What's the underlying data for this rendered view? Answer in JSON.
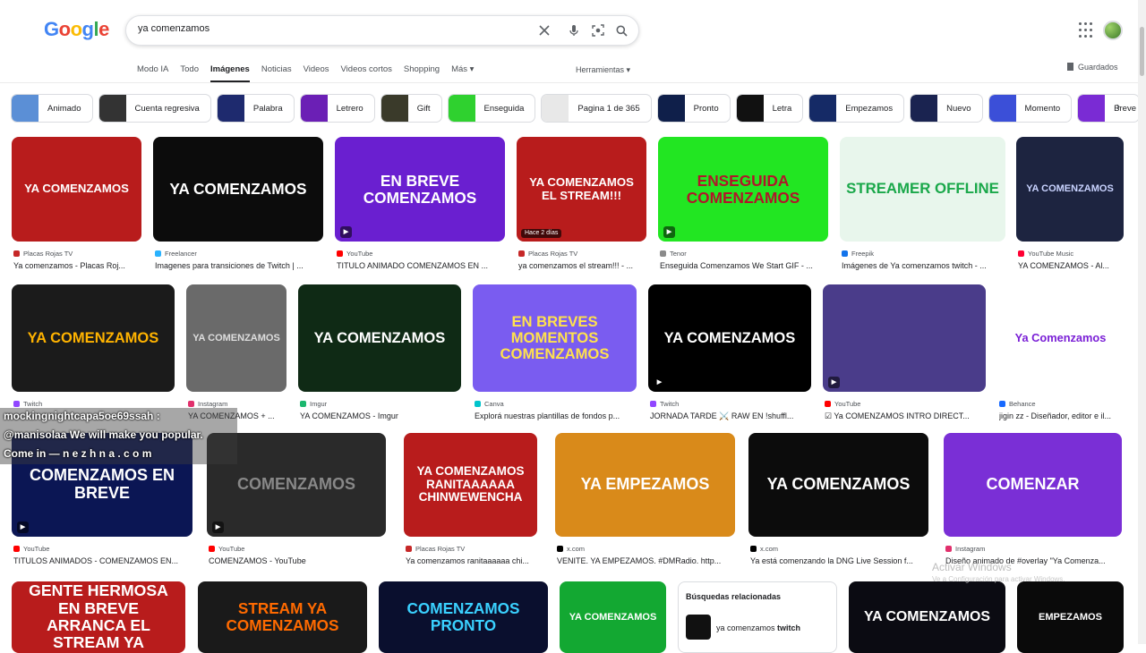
{
  "logo": {
    "letters": [
      "G",
      "o",
      "o",
      "g",
      "l",
      "e"
    ],
    "colors": [
      "#4285f4",
      "#ea4335",
      "#fbbc05",
      "#4285f4",
      "#34a853",
      "#ea4335"
    ]
  },
  "search": {
    "value": "ya comenzamos"
  },
  "tabs": [
    "Modo IA",
    "Todo",
    "Imágenes",
    "Noticias",
    "Videos",
    "Videos cortos",
    "Shopping",
    "Más ▾"
  ],
  "active_tab": "Imágenes",
  "tools_label": "Herramientas ▾",
  "saved_label": "Guardados",
  "chips": [
    {
      "label": "Animado",
      "color": "#5b8fd6"
    },
    {
      "label": "Cuenta regresiva",
      "color": "#333333"
    },
    {
      "label": "Palabra",
      "color": "#1e2a6e"
    },
    {
      "label": "Letrero",
      "color": "#6b1fb5"
    },
    {
      "label": "Gift",
      "color": "#3a3a2a"
    },
    {
      "label": "Enseguida",
      "color": "#2fd12f"
    },
    {
      "label": "Pagina 1 de 365",
      "color": "#e8e8e8"
    },
    {
      "label": "Pronto",
      "color": "#0f1f4a"
    },
    {
      "label": "Letra",
      "color": "#111111"
    },
    {
      "label": "Empezamos",
      "color": "#152a66"
    },
    {
      "label": "Nuevo",
      "color": "#1a2350"
    },
    {
      "label": "Momento",
      "color": "#3b4fd8"
    },
    {
      "label": "Breve",
      "color": "#7a2bd4"
    }
  ],
  "chat": {
    "line1": "mockingnightcapa5oe69ssah :",
    "line2": "@manisolaa We will make you popular.",
    "line3": "Come in — n e z h n a . c o m"
  },
  "row1": [
    {
      "text": "YA COMENZAMOS",
      "bg": "#b81c1c",
      "fg": "#ffffff",
      "src": "Placas Rojas TV",
      "icon": "#c62828",
      "title": "Ya comenzamos - Placas Roj...",
      "play": false
    },
    {
      "text": "YA COMENZAMOS",
      "bg": "#0c0c0c",
      "fg": "#ffffff",
      "src": "Freelancer",
      "icon": "#29b2fe",
      "title": "Imagenes para transiciones de Twitch | ...",
      "play": false
    },
    {
      "text": "EN BREVE COMENZAMOS",
      "bg": "#6a1fd0",
      "fg": "#ffffff",
      "src": "YouTube",
      "icon": "#ff0000",
      "title": "TITULO ANIMADO COMENZAMOS EN ...",
      "play": true
    },
    {
      "text": "YA COMENZAMOS EL STREAM!!!",
      "bg": "#b81c1c",
      "fg": "#ffffff",
      "src": "Placas Rojas TV",
      "icon": "#c62828",
      "title": "ya comenzamos el stream!!! - ...",
      "badge": "Hace 2 días"
    },
    {
      "text": "ENSEGUIDA COMENZAMOS",
      "bg": "#22e622",
      "fg": "#b0162a",
      "src": "Tenor",
      "icon": "#8a8a8a",
      "title": "Enseguida Comenzamos We Start GIF - ...",
      "play": true
    },
    {
      "text": "STREAMER OFFLINE",
      "bg": "#e8f6ec",
      "fg": "#1aa84a",
      "src": "Freepik",
      "icon": "#1273eb",
      "title": "Imágenes de Ya comenzamos twitch - ...",
      "play": false
    },
    {
      "text": "YA COMENZAMOS",
      "bg": "#1d2440",
      "fg": "#c9d3ff",
      "src": "YouTube Music",
      "icon": "#ff0033",
      "title": "YA COMENZAMOS - Al...",
      "play": false
    }
  ],
  "row2": [
    {
      "text": "YA COMENZAMOS",
      "bg": "#1b1b1b",
      "fg": "#ffb300",
      "src": "Twitch",
      "icon": "#9146ff",
      "title": "...",
      "play": false
    },
    {
      "text": "YA COMENZAMOS",
      "bg": "#6a6a6a",
      "fg": "#dddddd",
      "src": "Instagram",
      "icon": "#e1306c",
      "title": "YA COMENZAMOS + ...",
      "play": false
    },
    {
      "text": "YA COMENZAMOS",
      "bg": "#0f2a15",
      "fg": "#ffffff",
      "src": "Imgur",
      "icon": "#1bb76e",
      "title": "YA COMENZAMOS - Imgur",
      "play": false
    },
    {
      "text": "EN BREVES MOMENTOS COMENZAMOS",
      "bg": "#7a5cf0",
      "fg": "#ffe14d",
      "src": "Canva",
      "icon": "#00c4cc",
      "title": "Explorá nuestras plantillas de fondos p...",
      "play": false
    },
    {
      "text": "YA COMENZAMOS",
      "bg": "#000000",
      "fg": "#ffffff",
      "src": "Twitch",
      "icon": "#9146ff",
      "title": "JORNADA TARDE ⚔️ RAW EN !shuffl...",
      "play": true
    },
    {
      "text": "",
      "bg": "#4a3c8a",
      "fg": "#ffffff",
      "src": "YouTube",
      "icon": "#ff0000",
      "title": "☑ Ya COMENZAMOS INTRO DIRECT...",
      "play": true
    },
    {
      "text": "Ya Comenzamos",
      "bg": "#ffffff",
      "fg": "#7a1fd6",
      "src": "Behance",
      "icon": "#1769ff",
      "title": "jigin zz - Diseñador, editor e il...",
      "play": false
    }
  ],
  "row3": [
    {
      "text": "COMENZAMOS EN BREVE",
      "bg": "#0b1654",
      "fg": "#ffffff",
      "src": "YouTube",
      "icon": "#ff0000",
      "title": "TITULOS ANIMADOS - COMENZAMOS EN...",
      "play": true
    },
    {
      "text": "COMENZAMOS",
      "bg": "#2a2a2a",
      "fg": "#888888",
      "src": "YouTube",
      "icon": "#ff0000",
      "title": "COMENZAMOS - YouTube",
      "play": true
    },
    {
      "text": "YA COMENZAMOS RANITAAAAAA CHINWEWENCHA",
      "bg": "#b81c1c",
      "fg": "#ffffff",
      "src": "Placas Rojas TV",
      "icon": "#c62828",
      "title": "Ya comenzamos ranitaaaaaa chi...",
      "play": false
    },
    {
      "text": "YA EMPEZAMOS",
      "bg": "#d98a1a",
      "fg": "#ffffff",
      "src": "x.com",
      "icon": "#000000",
      "title": "VENITE. YA EMPEZAMOS. #DMRadio. http...",
      "play": false
    },
    {
      "text": "YA COMENZAMOS",
      "bg": "#0c0c0c",
      "fg": "#ffffff",
      "src": "x.com",
      "icon": "#000000",
      "title": "Ya está comenzando la DNG Live Session f...",
      "play": false
    },
    {
      "text": "COMENZAR",
      "bg": "#7a2fd6",
      "fg": "#ffffff",
      "src": "Instagram",
      "icon": "#e1306c",
      "title": "Diseño animado de #overlay \"Ya Comenza...",
      "play": false
    }
  ],
  "row4": [
    {
      "text": "GENTE HERMOSA EN BREVE ARRANCA EL STREAM YA",
      "bg": "#b81c1c",
      "fg": "#ffffff"
    },
    {
      "text": "STREAM YA COMENZAMOS",
      "bg": "#1a1a1a",
      "fg": "#ff6a00"
    },
    {
      "text": "COMENZAMOS PRONTO",
      "bg": "#0a0f2e",
      "fg": "#3ad1ff"
    },
    {
      "text": "YA COMENZAMOS",
      "bg": "#13a832",
      "fg": "#ffffff"
    },
    {
      "text": "YA COMENZAMOS",
      "bg": "#0b0b12",
      "fg": "#ffffff"
    },
    {
      "text": "EMPEZAMOS",
      "bg": "#0a0a0a",
      "fg": "#ffffff"
    }
  ],
  "related": {
    "heading": "Búsquedas relacionadas",
    "item_prefix": "ya comenzamos ",
    "item_bold": "twitch"
  },
  "watermark": {
    "line1": "Activar Windows",
    "line2": "Ve a Configuración para activar Windows."
  }
}
